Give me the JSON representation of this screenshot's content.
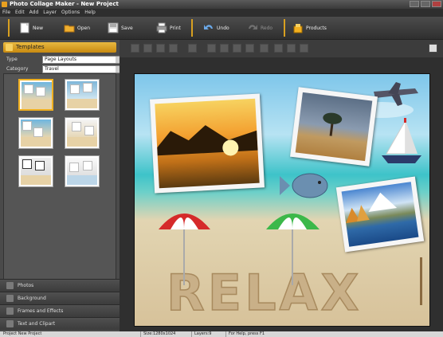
{
  "window": {
    "title": "Photo Collage Maker - New Project"
  },
  "menu": [
    "File",
    "Edit",
    "Add",
    "Layer",
    "Options",
    "Help"
  ],
  "toolbar": {
    "new": "New",
    "open": "Open",
    "save": "Save",
    "print": "Print",
    "undo": "Undo",
    "redo": "Redo",
    "products": "Products"
  },
  "left_panel": {
    "templates_header": "Templates",
    "type_label": "Type",
    "type_value": "Page Layouts",
    "category_label": "Category",
    "category_value": "Travel",
    "accordion": [
      "Photos",
      "Background",
      "Frames and Effects",
      "Text and Clipart"
    ]
  },
  "canvas": {
    "sand_text": "RELAX"
  },
  "status": {
    "project": "Project New Project",
    "size": "Size:1280x1024",
    "layers": "Layers:9",
    "help": "For Help, press F1"
  },
  "colors": {
    "accent": "#e8a020",
    "toolbar_bg": "#3a3a3a",
    "canvas_sea": "#3ec3c9"
  }
}
